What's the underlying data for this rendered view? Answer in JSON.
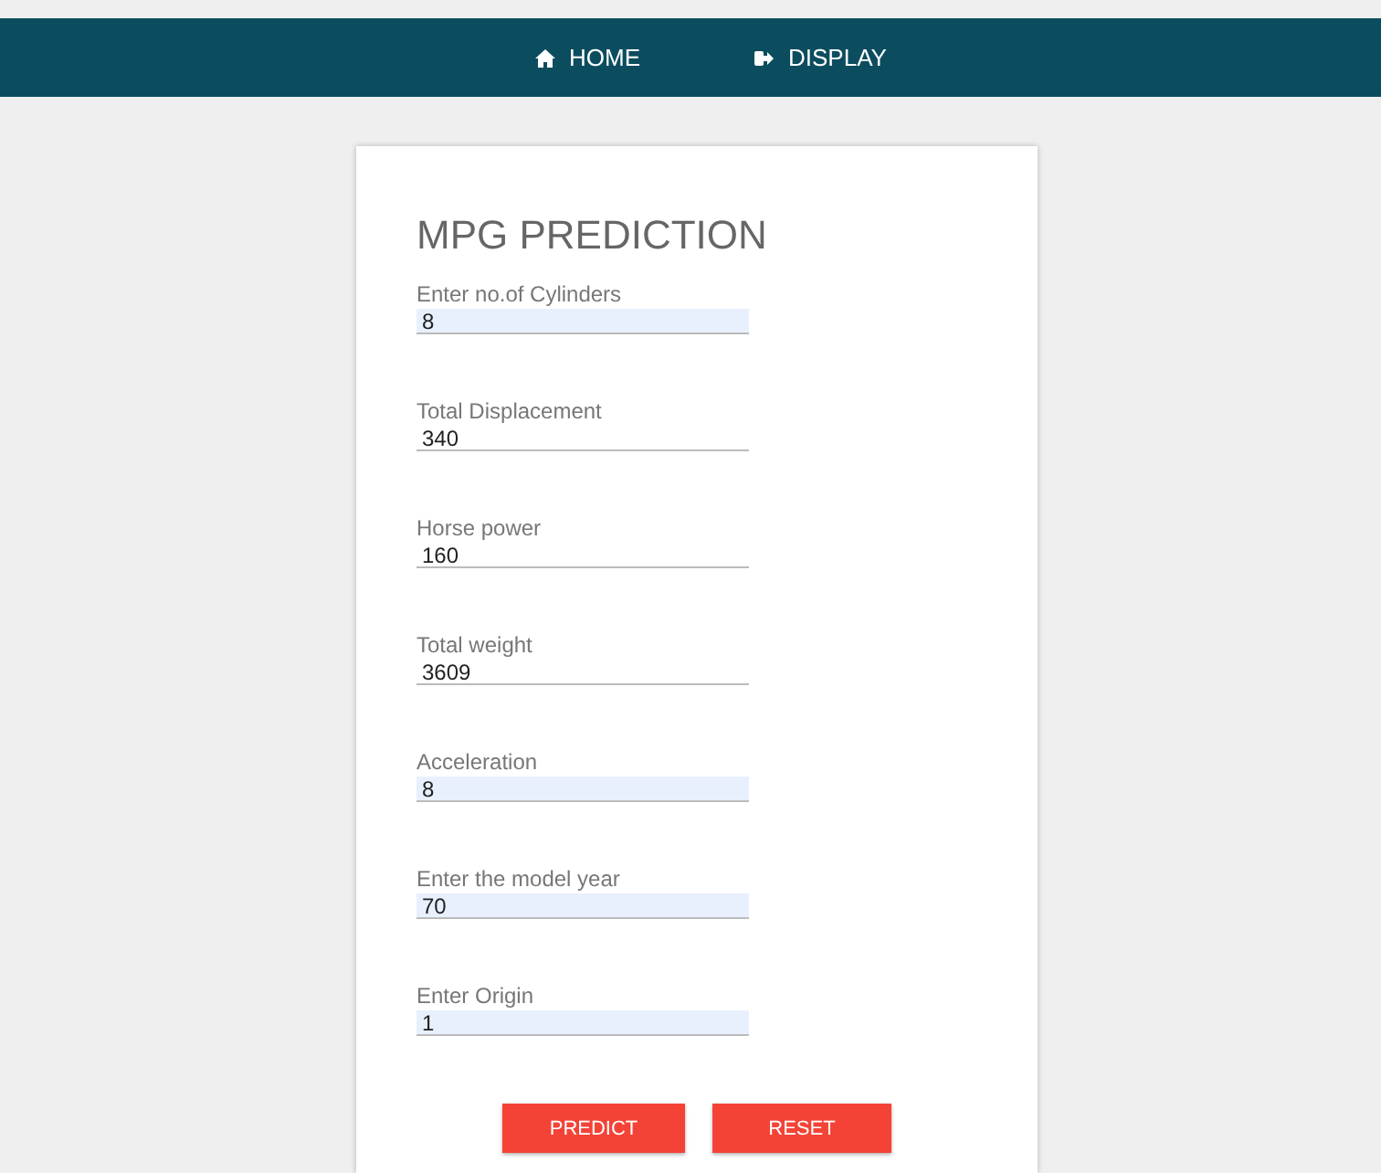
{
  "nav": [
    {
      "label": "HOME"
    },
    {
      "label": "DISPLAY"
    }
  ],
  "form": {
    "title": "MPG PREDICTION",
    "fields": [
      {
        "label": "Enter no.of Cylinders",
        "value": "8",
        "autofilled": true
      },
      {
        "label": "Total Displacement",
        "value": "340",
        "autofilled": false
      },
      {
        "label": "Horse power",
        "value": "160",
        "autofilled": false
      },
      {
        "label": "Total weight",
        "value": "3609",
        "autofilled": false
      },
      {
        "label": "Acceleration",
        "value": "8",
        "autofilled": true
      },
      {
        "label": "Enter the model year",
        "value": "70",
        "autofilled": true
      },
      {
        "label": "Enter Origin",
        "value": "1",
        "autofilled": true
      }
    ],
    "buttons": [
      "PREDICT",
      "RESET"
    ]
  }
}
